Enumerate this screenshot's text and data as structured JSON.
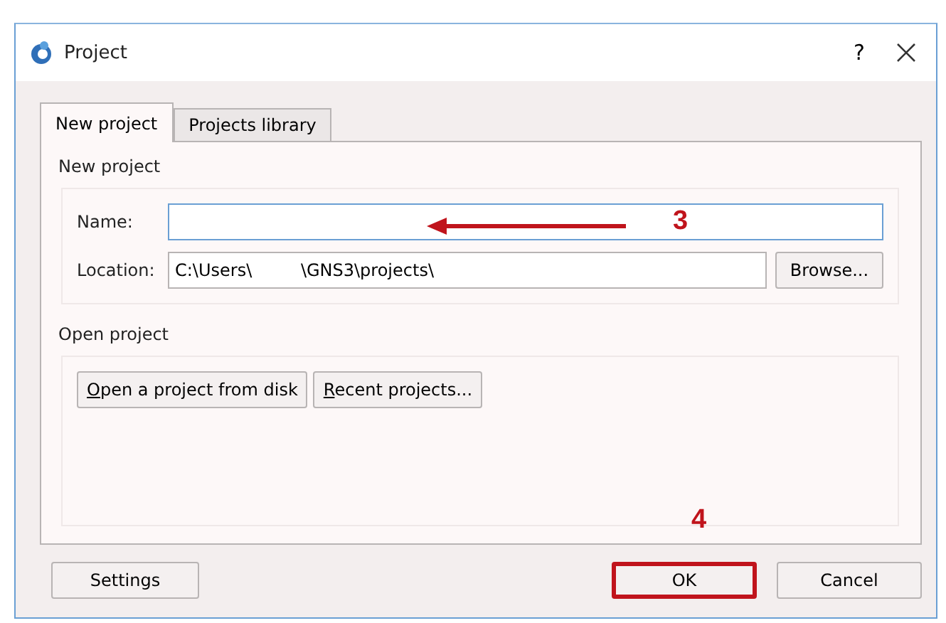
{
  "window": {
    "title": "Project",
    "help": "?"
  },
  "tabs": [
    {
      "label": "New project",
      "selected": true
    },
    {
      "label": "Projects library",
      "selected": false
    }
  ],
  "new_project": {
    "heading": "New project",
    "name": {
      "label": "Name:",
      "focused": true
    },
    "location": {
      "label": "Location:",
      "value": "C:\\Users\\         \\GNS3\\projects\\",
      "button": "Browse..."
    }
  },
  "open_project": {
    "heading": "Open project",
    "buttons": [
      {
        "label": "Open a project from disk",
        "mnemonic": true
      },
      {
        "label": "Recent projects...",
        "mnemonic": true
      }
    ]
  },
  "footer": [
    {
      "label": "Settings",
      "highlighted": false
    },
    {
      "label": "OK",
      "highlighted": true
    },
    {
      "label": "Cancel",
      "highlighted": false
    }
  ],
  "annotations": [
    {
      "text": "3",
      "kind": "arrow"
    },
    {
      "text": "4",
      "kind": "label"
    }
  ]
}
